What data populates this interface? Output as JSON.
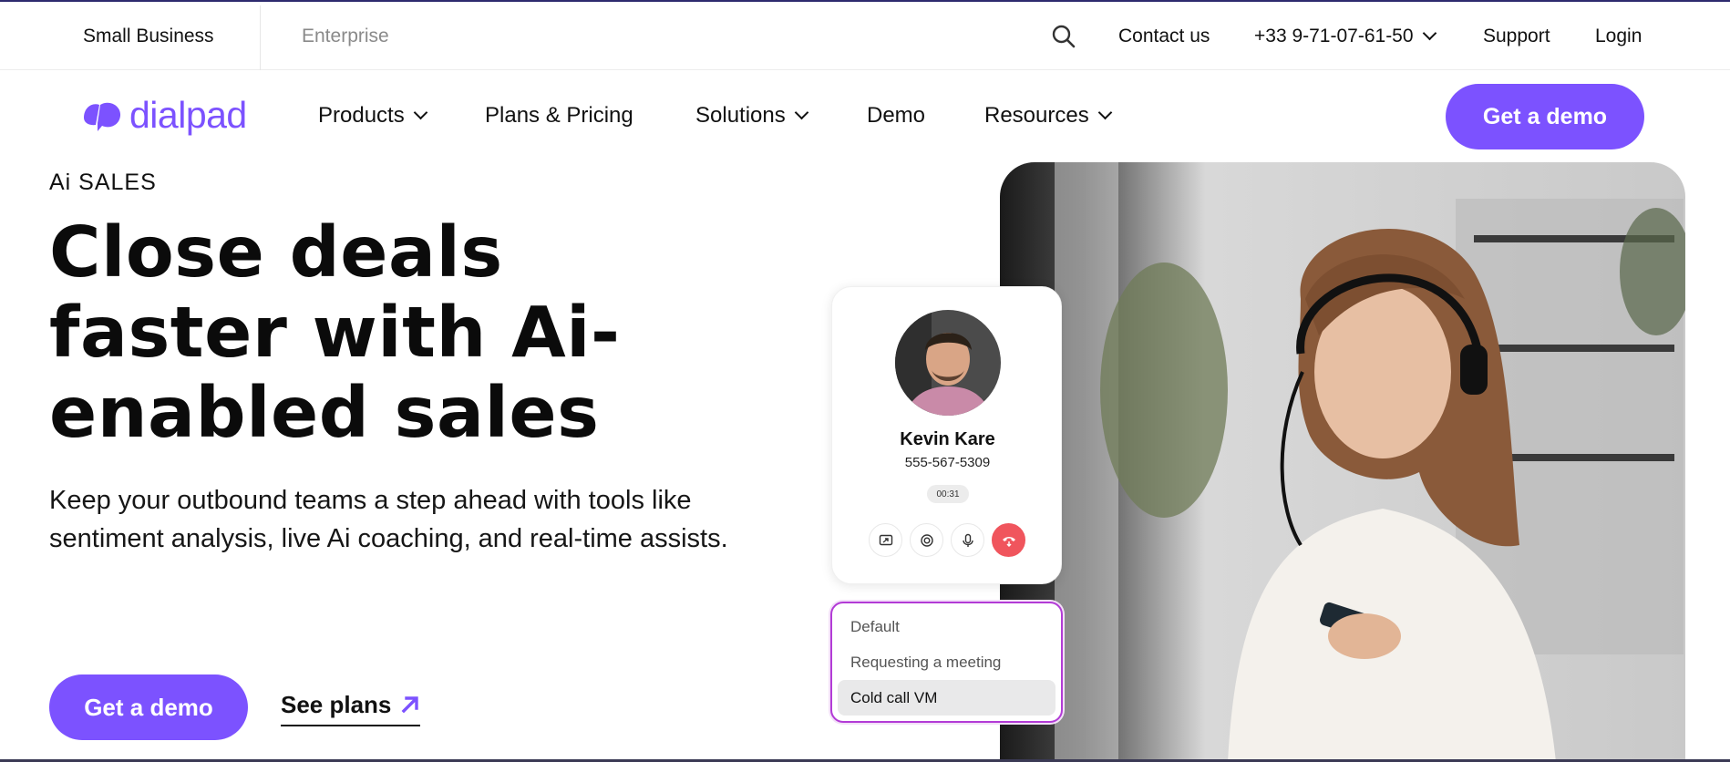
{
  "topbar": {
    "segments": [
      "Small Business",
      "Enterprise"
    ],
    "contact": "Contact us",
    "phone": "+33 9-71-07-61-50",
    "support": "Support",
    "login": "Login"
  },
  "brand": {
    "name": "dialpad",
    "color": "#7c52ff"
  },
  "nav": {
    "items": [
      "Products",
      "Plans & Pricing",
      "Solutions",
      "Demo",
      "Resources"
    ],
    "cta": "Get a demo"
  },
  "hero": {
    "eyebrow": "Ai SALES",
    "headline": "Close deals faster with Ai-enabled sales",
    "subtitle": "Keep your outbound teams a step ahead with tools like sentiment analysis, live Ai coaching, and real-time assists.",
    "cta": "Get a demo",
    "link": "See plans"
  },
  "call_card": {
    "name": "Kevin Kare",
    "phone": "555-567-5309",
    "timer": "00:31",
    "buttons": [
      "share-screen-icon",
      "record-icon",
      "microphone-icon",
      "end-call-icon"
    ],
    "end_color": "#f0555d"
  },
  "dropdown": {
    "options": [
      "Default",
      "Requesting a meeting",
      "Cold call VM"
    ],
    "selected": "Cold call VM",
    "border_color": "#b23bd6"
  }
}
